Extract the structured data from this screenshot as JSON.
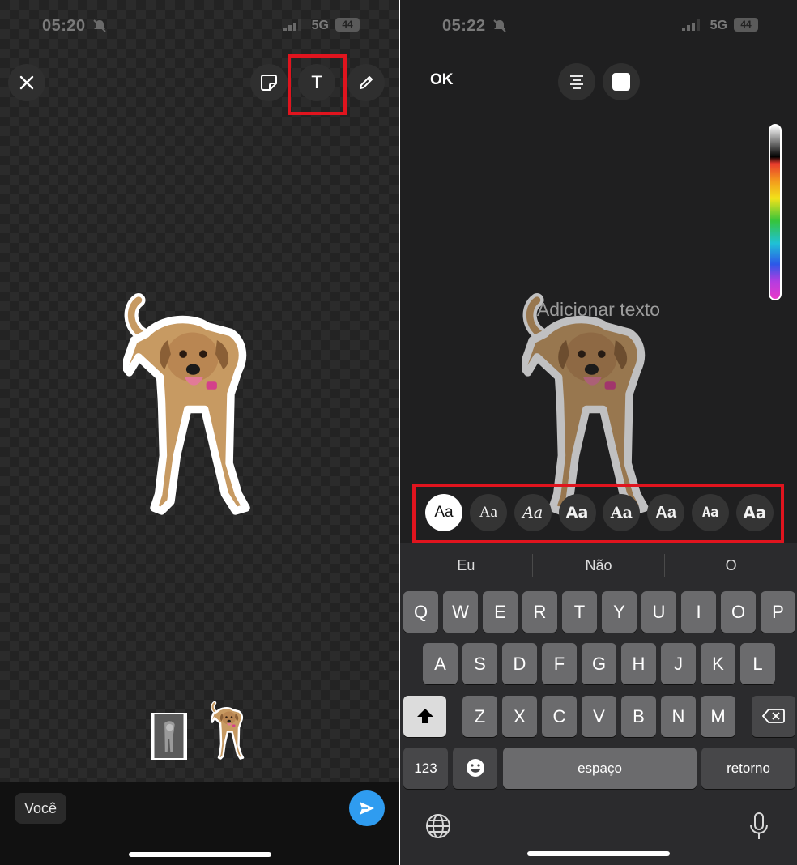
{
  "left_screen": {
    "status": {
      "time": "05:20",
      "network": "5G",
      "battery": "44"
    },
    "toolbar": {
      "close_icon": "close-icon",
      "sticker_icon": "sticker-icon",
      "text_icon_glyph": "T",
      "draw_icon": "pencil-icon"
    },
    "bottom": {
      "recipient_label": "Você",
      "send_icon": "send-icon"
    }
  },
  "right_screen": {
    "status": {
      "time": "05:22",
      "network": "5G",
      "battery": "44"
    },
    "toolbar": {
      "ok_label": "OK",
      "align_icon": "text-align-icon",
      "background_icon": "text-background-icon"
    },
    "text_placeholder": "Adicionar texto",
    "fonts": [
      "Aa",
      "Aa",
      "Aa",
      "Aa",
      "Aa",
      "Aa",
      "Aa",
      "Aa"
    ],
    "keyboard": {
      "suggestions": [
        "Eu",
        "Não",
        "O"
      ],
      "row1": [
        "Q",
        "W",
        "E",
        "R",
        "T",
        "Y",
        "U",
        "I",
        "O",
        "P"
      ],
      "row2": [
        "A",
        "S",
        "D",
        "F",
        "G",
        "H",
        "J",
        "K",
        "L"
      ],
      "row3": [
        "Z",
        "X",
        "C",
        "V",
        "B",
        "N",
        "M"
      ],
      "numbers_label": "123",
      "space_label": "espaço",
      "return_label": "retorno"
    }
  },
  "colors": {
    "highlight": "#e0141e",
    "send": "#2f9cf0",
    "dog_fur": "#c79a62"
  }
}
